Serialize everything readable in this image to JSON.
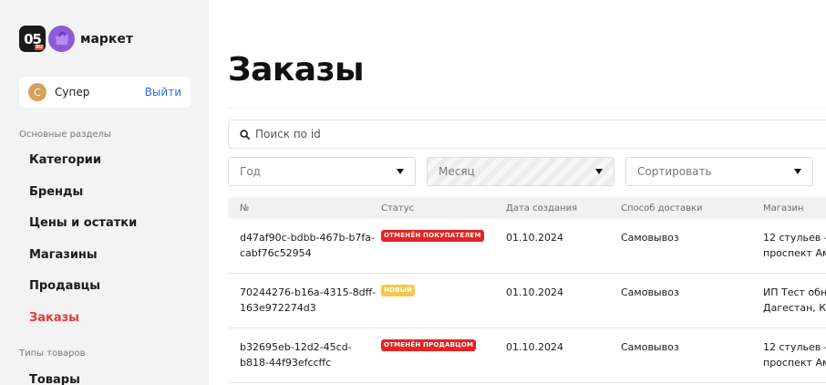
{
  "logo": {
    "mark": "05",
    "mark_suffix": "RU",
    "text": "маркет"
  },
  "user": {
    "initial": "С",
    "name": "Супер",
    "logout_label": "Выйти"
  },
  "nav": {
    "main_section": "Основные разделы",
    "items": [
      {
        "label": "Категории"
      },
      {
        "label": "Бренды"
      },
      {
        "label": "Цены и остатки"
      },
      {
        "label": "Магазины"
      },
      {
        "label": "Продавцы"
      },
      {
        "label": "Заказы"
      }
    ],
    "types_section": "Типы товаров",
    "types_items": [
      {
        "label": "Товары"
      }
    ]
  },
  "page": {
    "title": "Заказы"
  },
  "search": {
    "placeholder": "Поиск по id",
    "value": ""
  },
  "filters": {
    "year": "Год",
    "month": "Месяц",
    "sort": "Сортировать"
  },
  "table": {
    "headers": {
      "id": "№",
      "status": "Статус",
      "created": "Дата создания",
      "delivery": "Способ доставки",
      "store": "Магазин"
    },
    "rows": [
      {
        "id_line1": "d47af90c-bdbb-467b-b7fa-",
        "id_line2": "cabf76c52954",
        "status": "ОТМЕНЁН ПОКУПАТЕЛЕМ",
        "created": "01.10.2024",
        "delivery": "Самовывоз",
        "store_line1": "12 стульев —",
        "store_line2": "проспект Ам"
      },
      {
        "id_line1": "70244276-b16a-4315-8dff-",
        "id_line2": "163e972274d3",
        "status": "НОВЫЙ",
        "created": "01.10.2024",
        "delivery": "Самовывоз",
        "store_line1": "ИП Тест обно",
        "store_line2": "Дагестан, Ка"
      },
      {
        "id_line1": "b32695eb-12d2-45cd-",
        "id_line2": "b818-44f93efccffc",
        "status": "ОТМЕНЁН ПРОДАВЦОМ",
        "created": "01.10.2024",
        "delivery": "Самовывоз",
        "store_line1": "12 стульев —",
        "store_line2": "проспект Ам"
      }
    ]
  },
  "colors": {
    "accent_red": "#e53935",
    "link_blue": "#2f6fe4",
    "badge_red": "#e42323",
    "badge_yellow": "#f2c94c",
    "sidebar_bg": "#f3f3f4"
  }
}
